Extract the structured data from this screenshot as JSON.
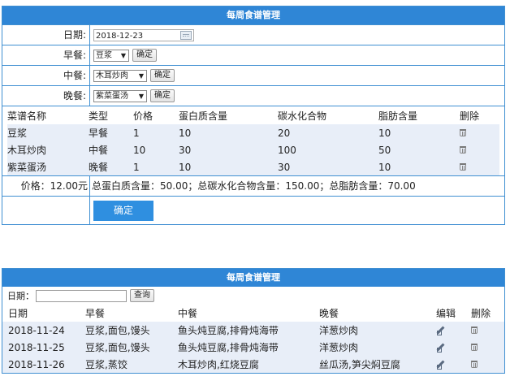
{
  "top_panel": {
    "title": "每周食谱管理",
    "date_label": "日期:",
    "date_value": "2018-12-23",
    "breakfast_label": "早餐:",
    "breakfast_value": "豆浆",
    "lunch_label": "中餐:",
    "lunch_value": "木耳炒肉",
    "dinner_label": "晚餐:",
    "dinner_value": "紫菜蛋汤",
    "confirm_label": "确定",
    "columns": [
      "菜谱名称",
      "类型",
      "价格",
      "蛋白质含量",
      "碳水化合物",
      "脂肪含量",
      "删除"
    ],
    "rows": [
      {
        "name": "豆浆",
        "type": "早餐",
        "price": "1",
        "protein": "10",
        "carb": "20",
        "fat": "10"
      },
      {
        "name": "木耳炒肉",
        "type": "中餐",
        "price": "10",
        "protein": "30",
        "carb": "100",
        "fat": "50"
      },
      {
        "name": "紫菜蛋汤",
        "type": "晚餐",
        "price": "1",
        "protein": "10",
        "carb": "30",
        "fat": "10"
      }
    ],
    "price_summary": "价格：12.00元",
    "nutrition_summary": "总蛋白质含量：50.00；总碳水化合物含量：150.00；总脂肪含量：70.00",
    "submit_label": "确定"
  },
  "history_panel": {
    "title": "每周食谱管理",
    "date_label": "日期：",
    "search_label": "查询",
    "columns": [
      "日期",
      "早餐",
      "中餐",
      "晚餐",
      "编辑",
      "删除"
    ],
    "rows": [
      {
        "date": "2018-11-24",
        "breakfast": "豆浆,面包,馒头",
        "lunch": "鱼头炖豆腐,排骨炖海带",
        "dinner": "洋葱炒肉"
      },
      {
        "date": "2018-11-25",
        "breakfast": "豆浆,面包,馒头",
        "lunch": "鱼头炖豆腐,排骨炖海带",
        "dinner": "洋葱炒肉"
      },
      {
        "date": "2018-11-26",
        "breakfast": "豆浆,蒸饺",
        "lunch": "木耳炒肉,红烧豆腐",
        "dinner": "丝瓜汤,笋尖焖豆腐"
      }
    ]
  },
  "colors": {
    "header_bg": "#2f86d6",
    "border": "#3f8fd2",
    "row_bg": "#e8eef8",
    "primary_button": "#2f8fe0"
  },
  "icons": {
    "calendar": "calendar-icon",
    "delete": "trash-icon",
    "edit": "edit-icon",
    "dropdown": "chevron-down-icon"
  }
}
